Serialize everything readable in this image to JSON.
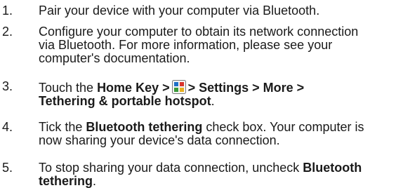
{
  "steps": [
    {
      "number": "1.",
      "line1": "Pair your device with your computer via Bluetooth."
    },
    {
      "number": "2.",
      "line1": "Configure your computer to obtain its network connection",
      "line2": "via Bluetooth. For more information, please see your",
      "line3": "computer's documentation."
    },
    {
      "number": "3.",
      "prefix": "Touch the ",
      "home_key": "Home Key >",
      "icon": "apps-grid-icon",
      "path": "> Settings > More >",
      "target": "Tethering & portable hotspot",
      "suffix": "."
    },
    {
      "number": "4.",
      "prefix": "Tick the ",
      "bold": "Bluetooth tethering",
      "rest": " check box. Your computer is",
      "line2": "now sharing your device's data connection."
    },
    {
      "number": "5.",
      "prefix": "To stop sharing your data connection, uncheck ",
      "bold1": "Bluetooth",
      "bold2": "tethering",
      "suffix": "."
    }
  ],
  "colors": {
    "text": "#1a1a1a",
    "icon_blue": "#1f6fc8",
    "icon_red": "#d9342b",
    "icon_green": "#3a9a3a",
    "icon_yellow": "#e8b020"
  }
}
